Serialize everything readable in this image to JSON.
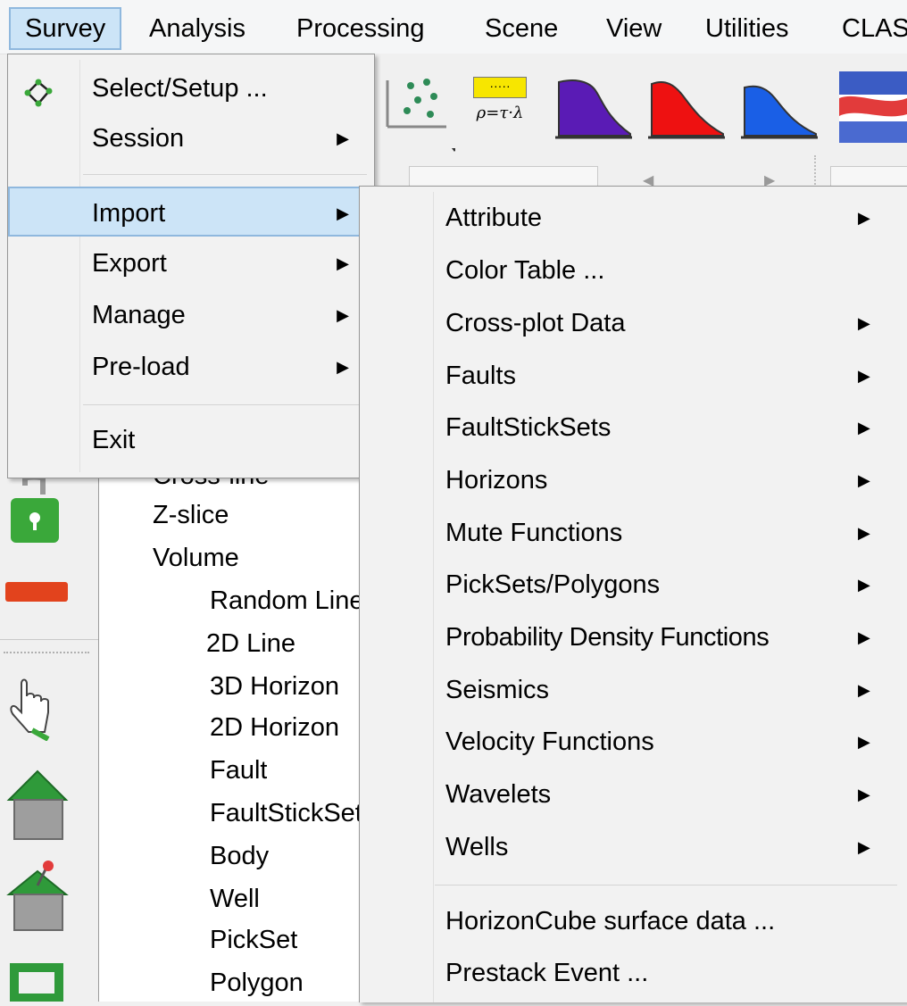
{
  "menubar": {
    "items": [
      "Survey",
      "Analysis",
      "Processing",
      "Scene",
      "View",
      "Utilities",
      "CLAS"
    ]
  },
  "toolbar": {
    "formula_label": "ρ=τ·λ"
  },
  "tree": {
    "items": [
      {
        "label": "Cross-line",
        "icon": "crossline-icon"
      },
      {
        "label": "Z-slice",
        "icon": "zslice-icon"
      },
      {
        "label": "Volume",
        "icon": "volume-icon"
      },
      {
        "label": "Random Line",
        "icon": "random-line-icon"
      },
      {
        "label": "2D Line",
        "icon": "2d-line-icon"
      },
      {
        "label": "3D Horizon",
        "icon": "3d-horizon-icon"
      },
      {
        "label": "2D Horizon",
        "icon": "2d-horizon-icon"
      },
      {
        "label": "Fault",
        "icon": "fault-icon"
      },
      {
        "label": "FaultStickSet",
        "icon": "faultstickset-icon"
      },
      {
        "label": "Body",
        "icon": "body-icon"
      },
      {
        "label": "Well",
        "icon": "well-icon"
      },
      {
        "label": "PickSet",
        "icon": "pickset-icon"
      },
      {
        "label": "Polygon",
        "icon": "polygon-icon"
      }
    ]
  },
  "survey_menu": {
    "items": [
      {
        "label": "Select/Setup ...",
        "submenu": false,
        "icon": "survey-setup-icon"
      },
      {
        "label": "Session",
        "submenu": true
      },
      {
        "label": "Import",
        "submenu": true,
        "highlighted": true
      },
      {
        "label": "Export",
        "submenu": true
      },
      {
        "label": "Manage",
        "submenu": true
      },
      {
        "label": "Pre-load",
        "submenu": true
      },
      {
        "label": "Exit",
        "submenu": false
      }
    ],
    "arrow_glyph": "▶"
  },
  "import_submenu": {
    "items": [
      {
        "label": "Attribute",
        "submenu": true
      },
      {
        "label": "Color Table ...",
        "submenu": false
      },
      {
        "label": "Cross-plot Data",
        "submenu": true
      },
      {
        "label": "Faults",
        "submenu": true
      },
      {
        "label": "FaultStickSets",
        "submenu": true
      },
      {
        "label": "Horizons",
        "submenu": true
      },
      {
        "label": "Mute Functions",
        "submenu": true
      },
      {
        "label": "PickSets/Polygons",
        "submenu": true
      },
      {
        "label": "Probability Density Functions",
        "submenu": true
      },
      {
        "label": "Seismics",
        "submenu": true
      },
      {
        "label": "Velocity Functions",
        "submenu": true
      },
      {
        "label": "Wavelets",
        "submenu": true
      },
      {
        "label": "Wells",
        "submenu": true
      },
      {
        "label": "HorizonCube surface data ...",
        "submenu": false
      },
      {
        "label": "Prestack Event ...",
        "submenu": false
      }
    ]
  },
  "colors": {
    "highlight_bg": "#cce4f7",
    "highlight_border": "#8fb8de",
    "menu_bg": "#f2f2f2"
  }
}
